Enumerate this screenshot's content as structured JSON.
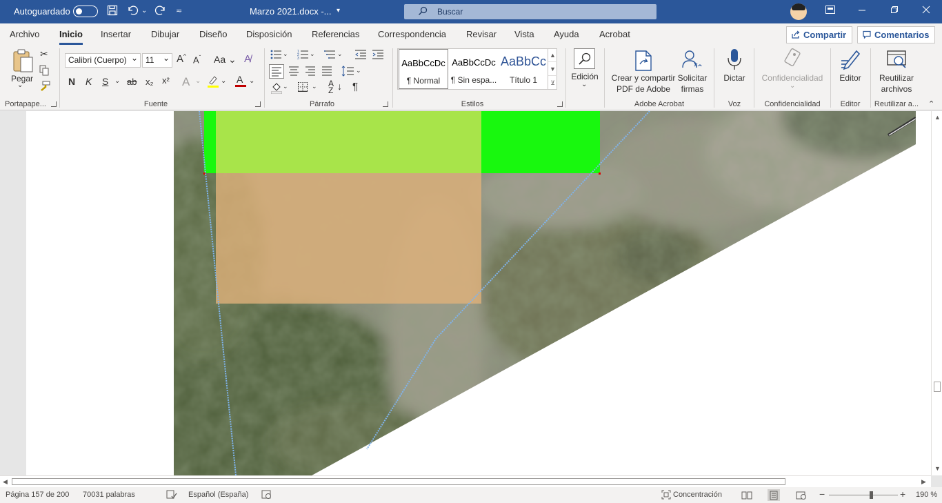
{
  "titlebar": {
    "autosave_label": "Autoguardado",
    "document_title": "Marzo 2021.docx  -...",
    "search_placeholder": "Buscar"
  },
  "tabs": [
    "Archivo",
    "Inicio",
    "Insertar",
    "Dibujar",
    "Diseño",
    "Disposición",
    "Referencias",
    "Correspondencia",
    "Revisar",
    "Vista",
    "Ayuda",
    "Acrobat"
  ],
  "active_tab": "Inicio",
  "share_label": "Compartir",
  "comments_label": "Comentarios",
  "ribbon": {
    "paste_label": "Pegar",
    "font_name": "Calibri (Cuerpo)",
    "font_size": "11",
    "bold": "N",
    "italic": "K",
    "underline": "S",
    "strike": "ab",
    "subscript": "x₂",
    "superscript": "x²",
    "styles": [
      {
        "preview": "AaBbCcDc",
        "name": "¶ Normal"
      },
      {
        "preview": "AaBbCcDc",
        "name": "¶ Sin espa..."
      },
      {
        "preview": "AaBbCc",
        "name": "Título 1"
      }
    ],
    "edicion_label": "Edición",
    "acrobat_create_label_1": "Crear y compartir",
    "acrobat_create_label_2": "PDF de Adobe",
    "acrobat_sign_label_1": "Solicitar",
    "acrobat_sign_label_2": "firmas",
    "dictar_label": "Dictar",
    "confidencialidad_label": "Confidencialidad",
    "editor_label": "Editor",
    "reutilizar_label_1": "Reutilizar",
    "reutilizar_label_2": "archivos",
    "groups": {
      "portapapeles": "Portapape...",
      "fuente": "Fuente",
      "parrafo": "Párrafo",
      "estilos": "Estilos",
      "adobe_acrobat": "Adobe Acrobat",
      "voz": "Voz",
      "confidencialidad": "Confidencialidad",
      "editor": "Editor",
      "reutilizar": "Reutilizar a..."
    }
  },
  "status": {
    "page": "Página 157 de 200",
    "words": "70031 palabras",
    "language": "Español (España)",
    "focus": "Concentración",
    "zoom": "190 %",
    "zoom_value_percent": 190
  },
  "colors": {
    "titlebar": "#2b579a",
    "highlight_green": "#a8e44a",
    "bright_green": "#18f80e",
    "tan_overlay": "#e0b27a",
    "font_color_red": "#c00000",
    "highlight_yellow": "#ffff00"
  }
}
